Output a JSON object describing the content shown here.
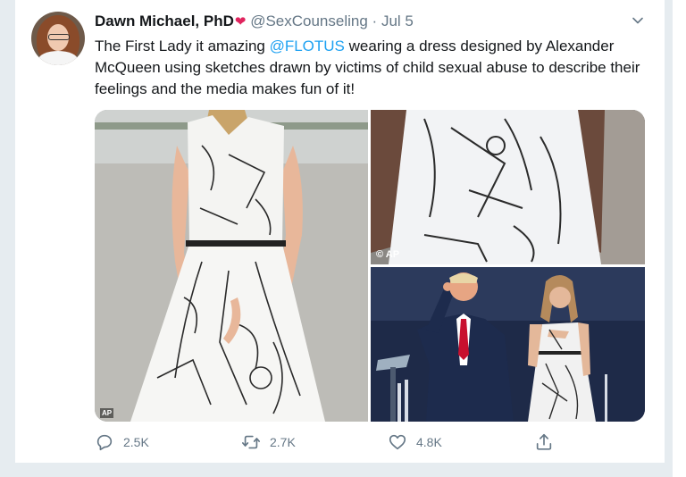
{
  "tweet": {
    "author": {
      "name": "Dawn Michael, PhD",
      "emoji": "❤",
      "handle": "@SexCounseling",
      "separator": "·",
      "date": "Jul 5"
    },
    "text": {
      "part1": "The First Lady it amazing ",
      "mention": "@FLOTUS",
      "part2": " wearing a dress designed by Alexander McQueen using sketches drawn by victims of child sexual abuse to describe their feelings and the media makes fun of it!"
    },
    "media": {
      "photo_credit_top": "© AP",
      "photo_credit_left": "AP"
    },
    "actions": {
      "reply_count": "2.5K",
      "retweet_count": "2.7K",
      "like_count": "4.8K"
    }
  },
  "colors": {
    "link": "#1da1f2",
    "secondary_text": "#657786",
    "heart": "#e0245e",
    "frame": "#e6ecf0"
  },
  "icons": [
    "chevron-down-icon",
    "reply-icon",
    "retweet-icon",
    "like-icon",
    "share-icon"
  ]
}
